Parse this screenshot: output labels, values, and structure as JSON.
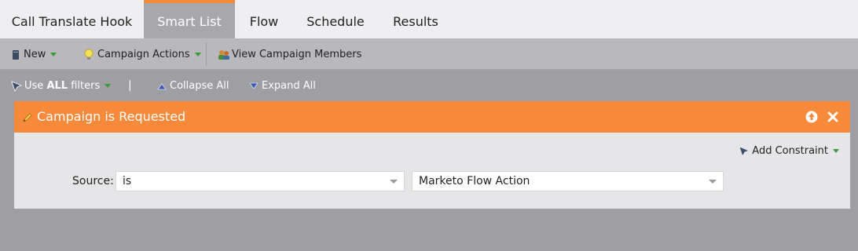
{
  "tabs": [
    {
      "label": "Call Translate Hook",
      "active": false
    },
    {
      "label": "Smart List",
      "active": true
    },
    {
      "label": "Flow",
      "active": false
    },
    {
      "label": "Schedule",
      "active": false
    },
    {
      "label": "Results",
      "active": false
    }
  ],
  "toolbar": {
    "new_label": "New",
    "campaign_actions_label": "Campaign Actions",
    "view_members_label": "View Campaign Members"
  },
  "filterbar": {
    "use_prefix": "Use",
    "use_strong": "ALL",
    "use_suffix": "filters",
    "separator": "|",
    "collapse_label": "Collapse All",
    "expand_label": "Expand All"
  },
  "filter": {
    "title": "Campaign is Requested",
    "add_constraint_label": "Add Constraint",
    "source_label": "Source:",
    "operator_value": "is",
    "value": "Marketo Flow Action"
  },
  "colors": {
    "accent": "#f7893a",
    "panel": "#e6e6e8",
    "toolbar": "#b9b9bd",
    "background": "#9e9ea3"
  },
  "icons": [
    "document-icon",
    "lightbulb-icon",
    "people-icon",
    "funnel-icon",
    "collapse-icon",
    "expand-icon",
    "pencil-icon",
    "move-up-icon",
    "close-icon",
    "dropdown-icon"
  ]
}
